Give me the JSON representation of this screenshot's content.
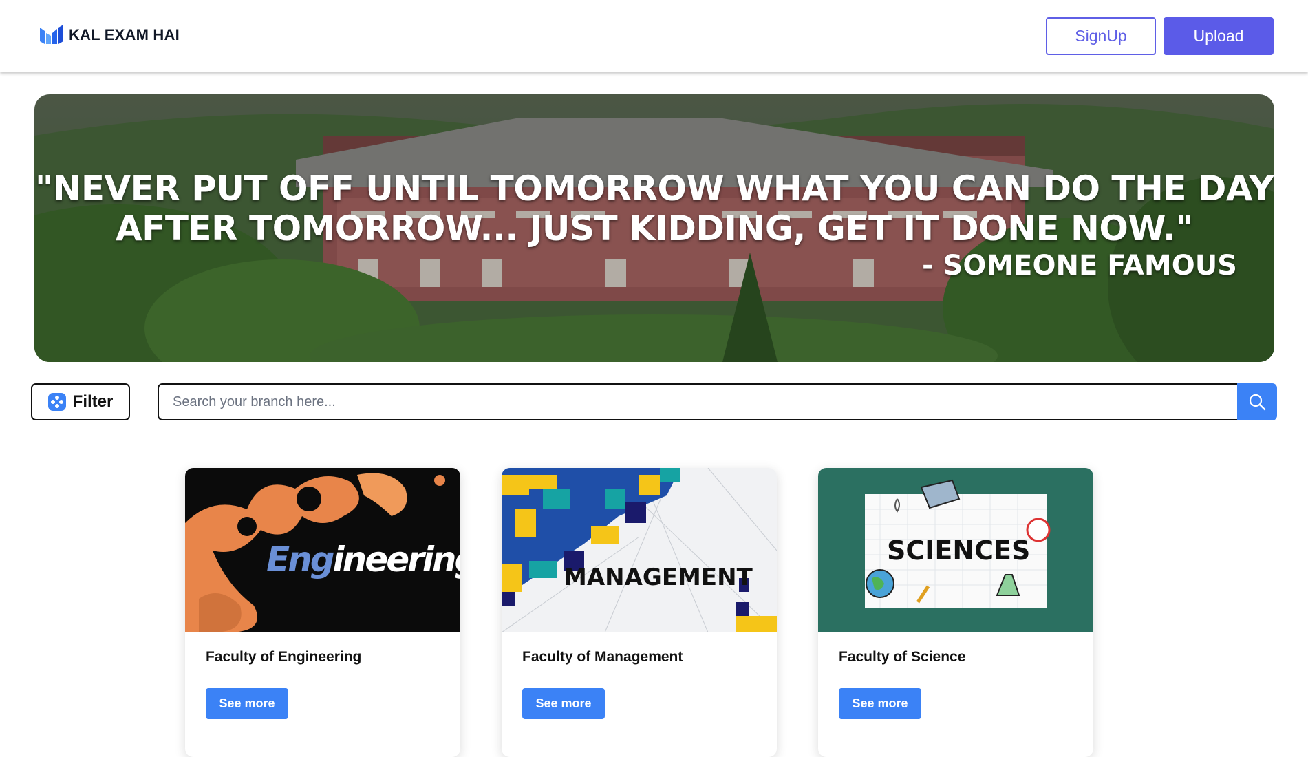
{
  "header": {
    "brand": "KAL EXAM HAI",
    "signup_label": "SignUp",
    "upload_label": "Upload"
  },
  "banner": {
    "quote_line1": "\"NEVER PUT OFF UNTIL TOMORROW WHAT YOU CAN DO THE DAY",
    "quote_line2": "AFTER TOMORROW... JUST KIDDING, GET IT DONE NOW.\"",
    "author": "- SOMEONE FAMOUS"
  },
  "toolbar": {
    "filter_label": "Filter",
    "search_placeholder": "Search your branch here..."
  },
  "cards": [
    {
      "image_text": "Engineering",
      "title": "Faculty of Engineering",
      "button": "See more"
    },
    {
      "image_text": "MANAGEMENT",
      "title": "Faculty of Management",
      "button": "See more"
    },
    {
      "image_text": "SCIENCES",
      "title": "Faculty of Science",
      "button": "See more"
    }
  ],
  "colors": {
    "accent": "#5b5be8",
    "button_blue": "#3b82f6"
  }
}
